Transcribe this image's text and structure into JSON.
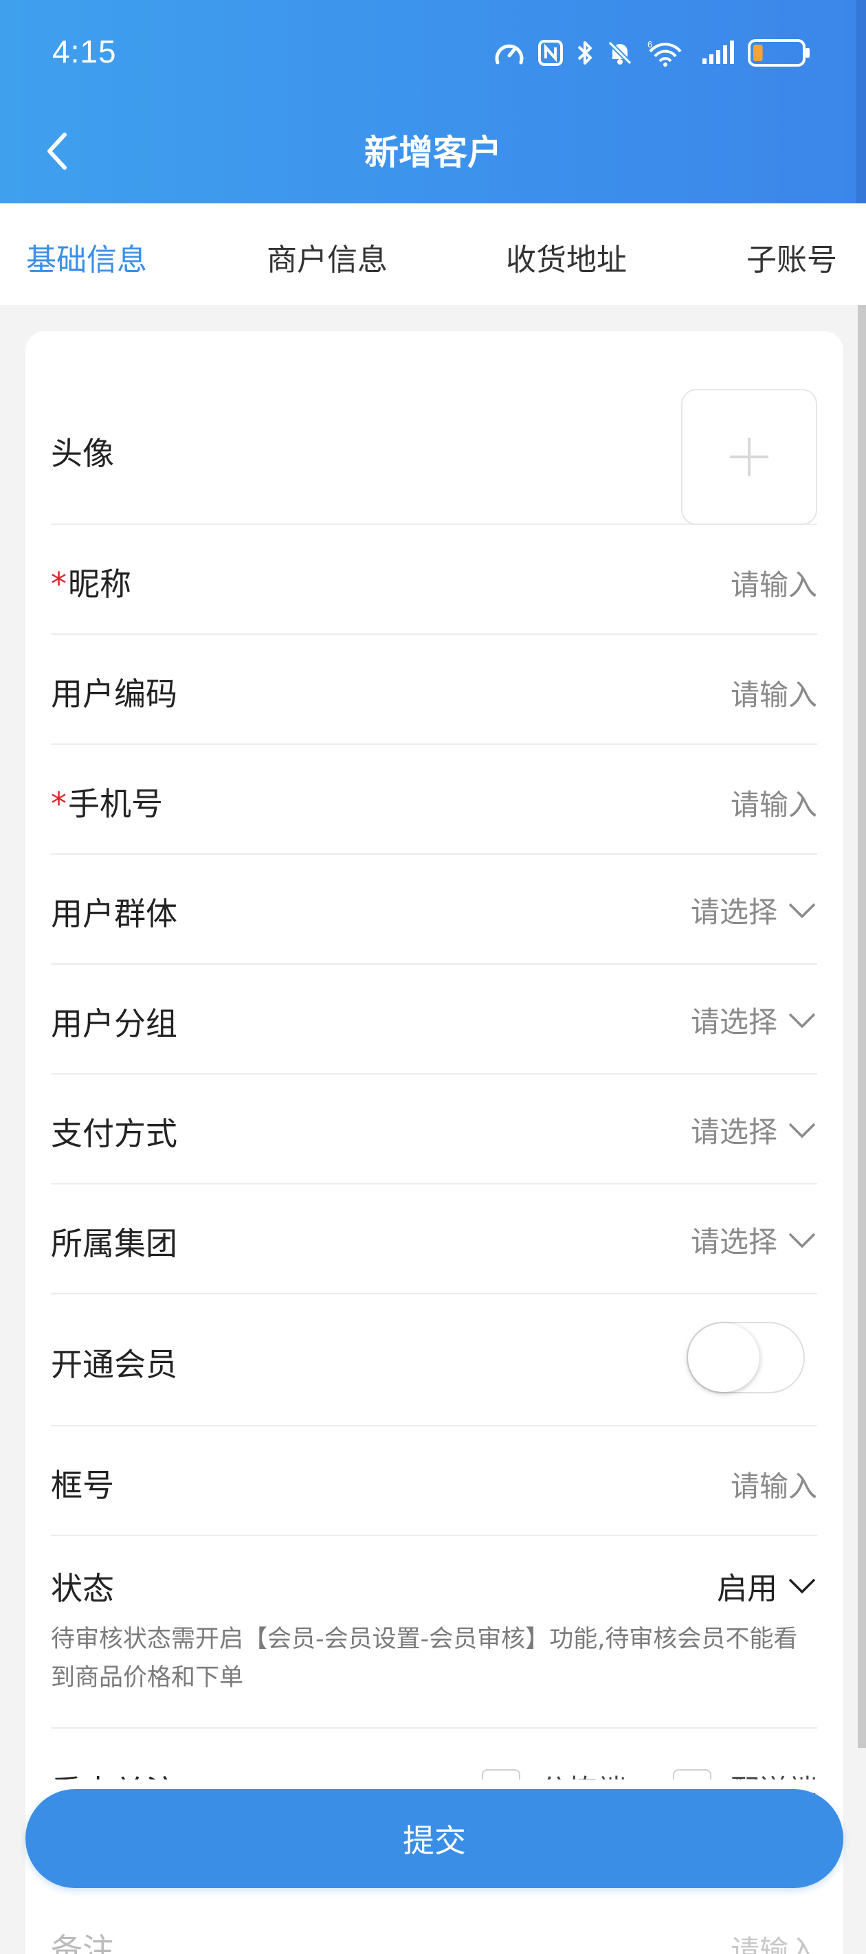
{
  "status_bar": {
    "time": "4:15",
    "icons": [
      "speed-icon",
      "nfc-icon",
      "bluetooth-icon",
      "mute-bell-icon",
      "wifi-6-icon",
      "signal-icon",
      "battery-icon"
    ],
    "wifi_label": "6",
    "battery_level": 0.2
  },
  "nav": {
    "title": "新增客户",
    "back_icon": "chevron-left-icon"
  },
  "tabs": [
    {
      "label": "基础信息",
      "active": true
    },
    {
      "label": "商户信息",
      "active": false
    },
    {
      "label": "收货地址",
      "active": false
    },
    {
      "label": "子账号",
      "active": false
    }
  ],
  "form": {
    "avatar": {
      "label": "头像",
      "icon": "plus-icon"
    },
    "nickname": {
      "label": "昵称",
      "required": true,
      "placeholder": "请输入"
    },
    "user_code": {
      "label": "用户编码",
      "placeholder": "请输入"
    },
    "phone": {
      "label": "手机号",
      "required": true,
      "placeholder": "请输入"
    },
    "user_group_type": {
      "label": "用户群体",
      "placeholder": "请选择"
    },
    "user_group": {
      "label": "用户分组",
      "placeholder": "请选择"
    },
    "payment": {
      "label": "支付方式",
      "placeholder": "请选择"
    },
    "company": {
      "label": "所属集团",
      "placeholder": "请选择"
    },
    "membership": {
      "label": "开通会员",
      "enabled": false
    },
    "frame_no": {
      "label": "框号",
      "placeholder": "请输入"
    },
    "status": {
      "label": "状态",
      "value": "启用",
      "hint": "待审核状态需开启【会员-会员设置-会员审核】功能,待审核会员不能看到商品价格和下单"
    },
    "focus": {
      "label": "重点关注",
      "options": [
        "分拣端",
        "配送端"
      ]
    },
    "remark": {
      "label": "备注",
      "placeholder": "请输入"
    },
    "required_mark": "*"
  },
  "submit_label": "提交",
  "colors": {
    "accent": "#3a8ee6",
    "header_gradient_start": "#3fa0ee",
    "required": "#e0262d"
  }
}
